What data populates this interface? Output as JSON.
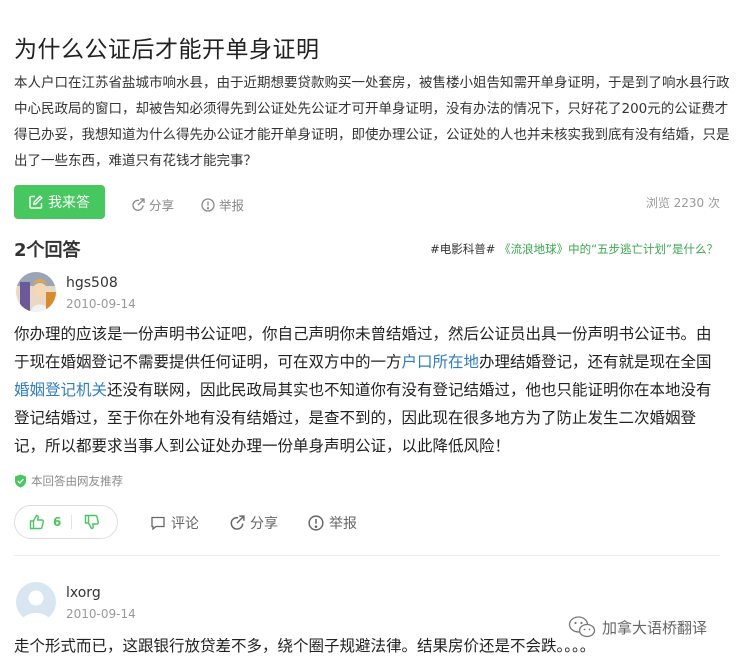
{
  "question": {
    "title": "为什么公证后才能开单身证明",
    "description": "本人户口在江苏省盐城市响水县，由于近期想要贷款购买一处套房，被售楼小姐告知需开单身证明，于是到了响水县行政中心民政局的窗口，却被告知必须得先到公证处先公证才可开单身证明，没有办法的情况下，只好花了200元的公证费才得已办妥，我想知道为什么得先办公证才能开单身证明，即使办理公证，公证处的人也并未核实我到底有没有结婚，只是出了一些东西，难道只有花钱才能完事？",
    "answer_button": "我来答",
    "share": "分享",
    "report": "举报",
    "views": "浏览 2230 次"
  },
  "answers_header": {
    "count": "2个回答",
    "topic_tag": "#电影科普#",
    "topic_title": "《流浪地球》中的“五步逃亡计划”是什么？"
  },
  "answer1": {
    "username": "hgs508",
    "date": "2010-09-14",
    "text_1": "你办理的应该是一份声明书公证吧，你自己声明你未曾结婚过，然后公证员出具一份声明书公证书。由于现在婚姻登记不需要提供任何证明，可在双方中的一方",
    "link_1": "户口所在地",
    "text_2": "办理结婚登记，还有就是现在全国",
    "link_2": "婚姻登记机关",
    "text_3": "还没有联网，因此民政局其实也不知道你有没有登记结婚过，他也只能证明你在本地没有登记结婚过，至于你在外地有没有结婚过，是查不到的，因此现在很多地方为了防止发生二次婚姻登记，所以都要求当事人到公证处办理一份单身声明公证，以此降低风险！",
    "recommended": "本回答由网友推荐",
    "likes": "6",
    "comment": "评论",
    "share": "分享",
    "report": "举报"
  },
  "answer2": {
    "username": "lxorg",
    "date": "2010-09-14",
    "text": "走个形式而已，这跟银行放贷差不多，绕个圈子规避法律。结果房价还是不会跌。。。。"
  },
  "watermark": {
    "text": "加拿大语桥翻译"
  },
  "colors": {
    "accent_green": "#47c85f",
    "link_blue": "#2e7cc7",
    "muted_gray": "#999999"
  }
}
